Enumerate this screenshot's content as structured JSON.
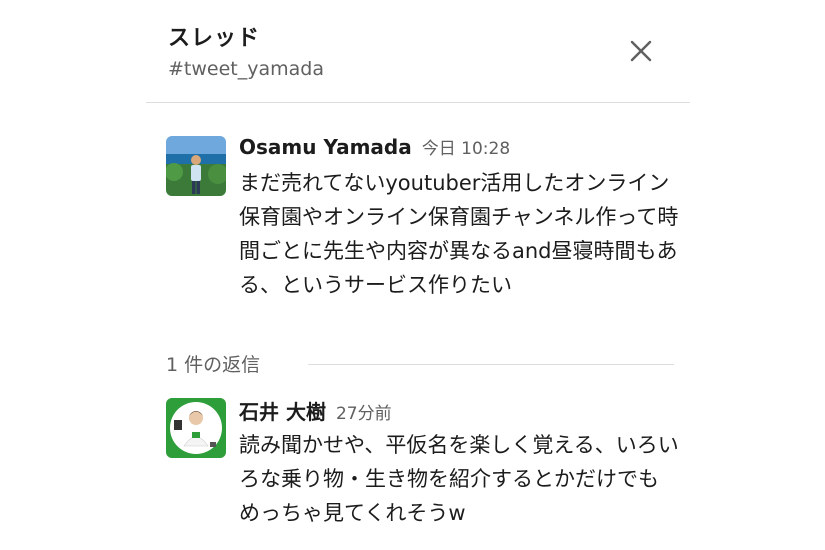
{
  "thread": {
    "title": "スレッド",
    "channel": "#tweet_yamada"
  },
  "icons": {
    "close": "close-icon"
  },
  "messages": [
    {
      "author": "Osamu Yamada",
      "time": "今日 10:28",
      "text": "まだ売れてないyoutuber活用したオンライン保育園やオンライン保育園チャンネル作って時間ごとに先生や内容が異なるand昼寝時間もある、というサービス作りたい"
    },
    {
      "author": "石井 大樹",
      "time": "27分前",
      "text": "読み聞かせや、平仮名を楽しく覚える、いろいろな乗り物・生き物を紹介するとかだけでもめっちゃ見てくれそうw"
    }
  ],
  "replies": {
    "count_label": "1 件の返信"
  },
  "colors": {
    "text": "#1d1c1d",
    "muted": "#616061",
    "divider": "#dddddd",
    "avatar2_border": "#2e9e3a"
  }
}
